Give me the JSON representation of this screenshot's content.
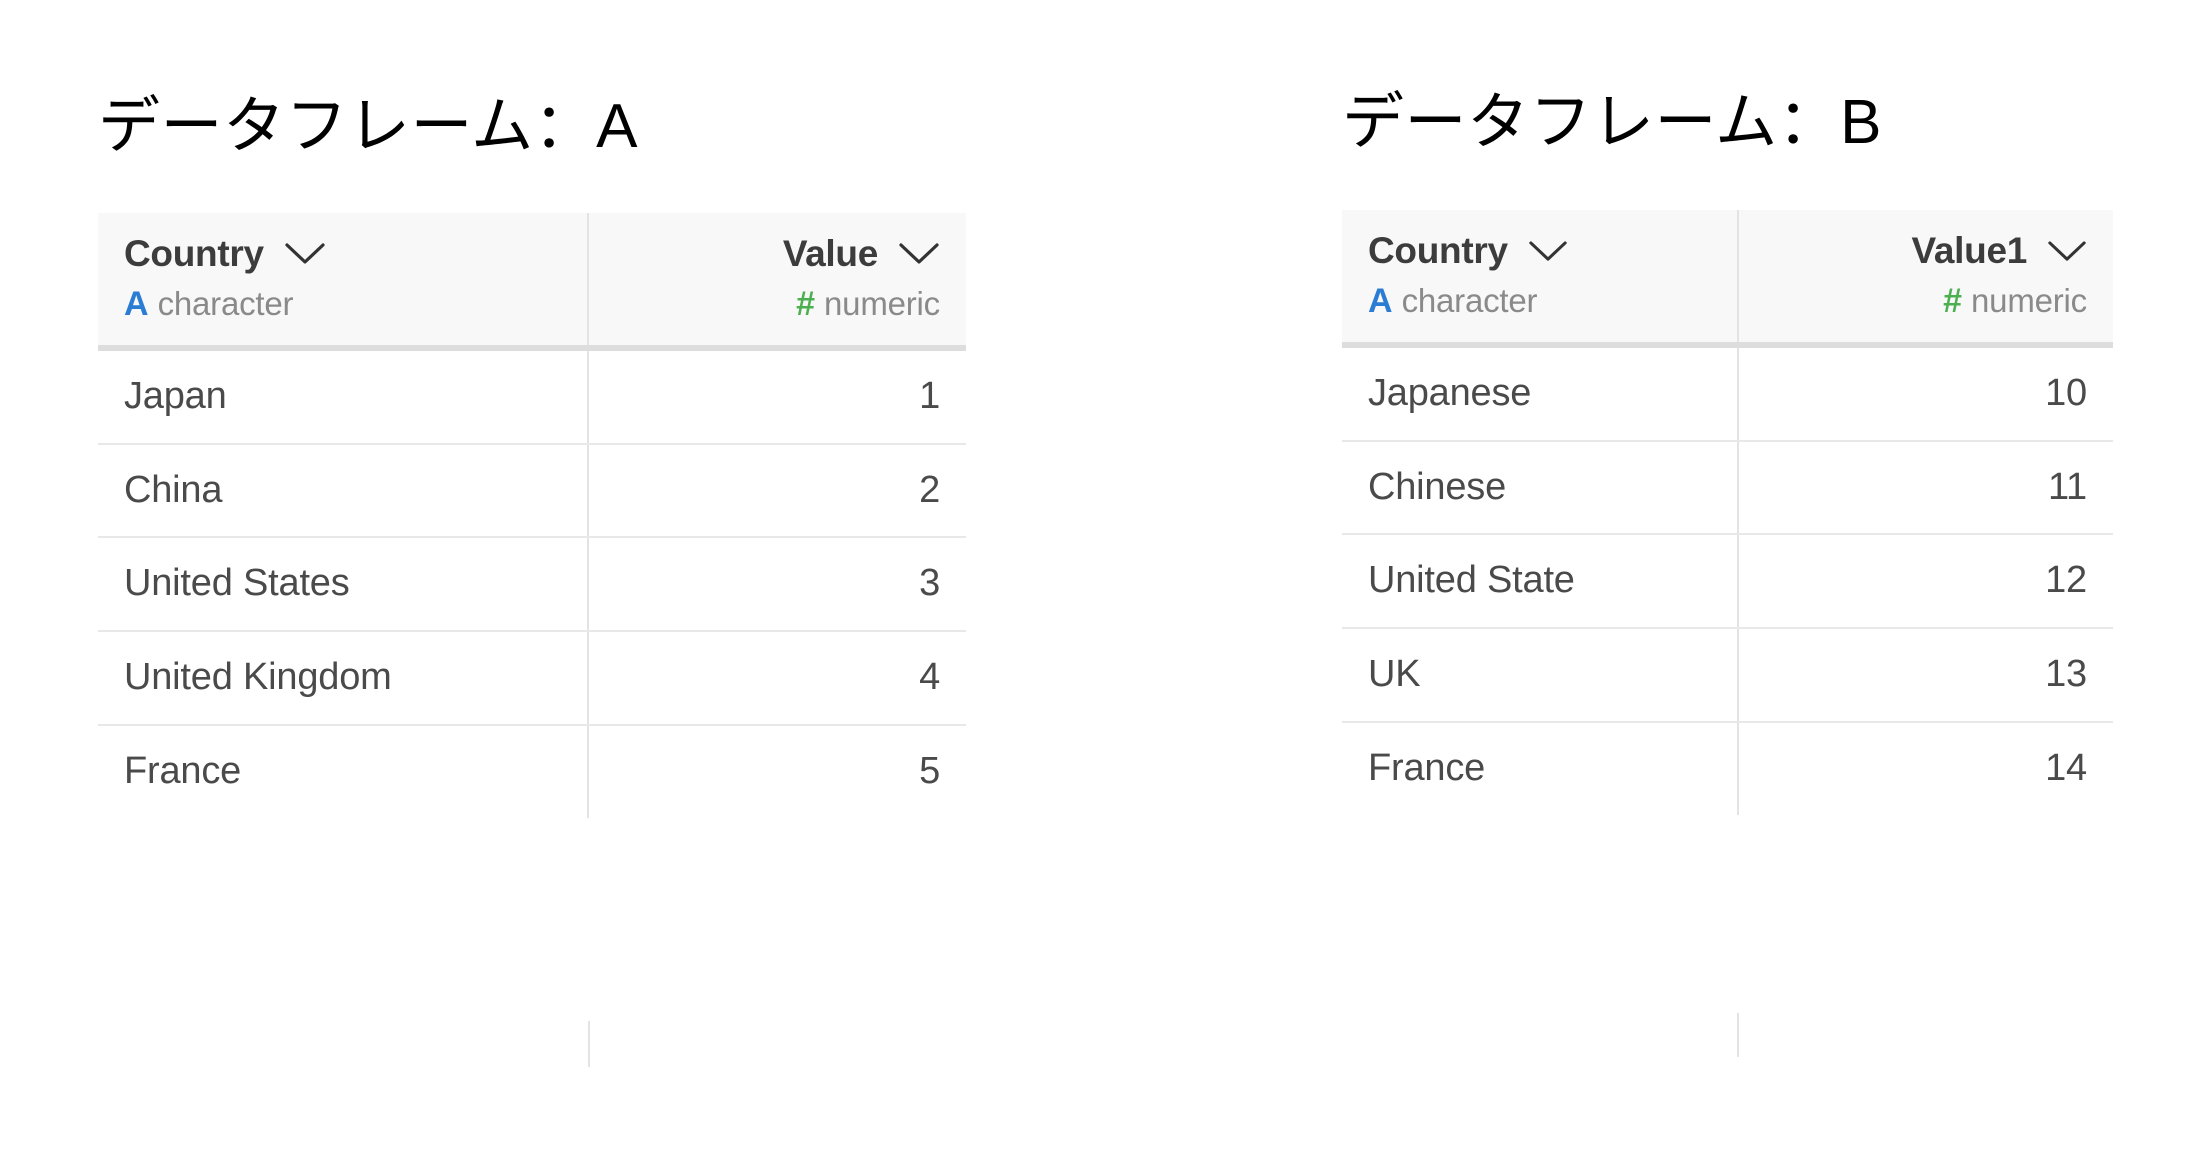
{
  "page": {
    "background": "#ffffff",
    "accents": {
      "character_type": "#2b7cd3",
      "numeric_type": "#4caf50",
      "header_background": "#f8f8f8",
      "header_rule": "#dddddd",
      "row_rule": "#e8e8e8",
      "column_rule": "#e3e3e3",
      "header_text": "#3c3c3c",
      "body_text": "#4a4a4a",
      "type_label_text": "#8a8a8a"
    }
  },
  "tables": [
    {
      "id": "a",
      "title": "データフレーム：A",
      "columns": [
        {
          "name": "Country",
          "type_glyph": "A",
          "type_label": "character",
          "type_kind": "character",
          "align": "left",
          "sort_icon": "chevron-down-icon"
        },
        {
          "name": "Value",
          "type_glyph": "#",
          "type_label": "numeric",
          "type_kind": "numeric",
          "align": "right",
          "sort_icon": "chevron-down-icon"
        }
      ],
      "rows": [
        {
          "Country": "Japan",
          "Value": "1"
        },
        {
          "Country": "China",
          "Value": "2"
        },
        {
          "Country": "United States",
          "Value": "3"
        },
        {
          "Country": "United Kingdom",
          "Value": "4"
        },
        {
          "Country": "France",
          "Value": "5"
        }
      ]
    },
    {
      "id": "b",
      "title": "データフレーム：B",
      "columns": [
        {
          "name": "Country",
          "type_glyph": "A",
          "type_label": "character",
          "type_kind": "character",
          "align": "left",
          "sort_icon": "chevron-down-icon"
        },
        {
          "name": "Value1",
          "type_glyph": "#",
          "type_label": "numeric",
          "type_kind": "numeric",
          "align": "right",
          "sort_icon": "chevron-down-icon"
        }
      ],
      "rows": [
        {
          "Country": "Japanese",
          "Value1": "10"
        },
        {
          "Country": "Chinese",
          "Value1": "11"
        },
        {
          "Country": "United State",
          "Value1": "12"
        },
        {
          "Country": "UK",
          "Value1": "13"
        },
        {
          "Country": "France",
          "Value1": "14"
        }
      ]
    }
  ]
}
